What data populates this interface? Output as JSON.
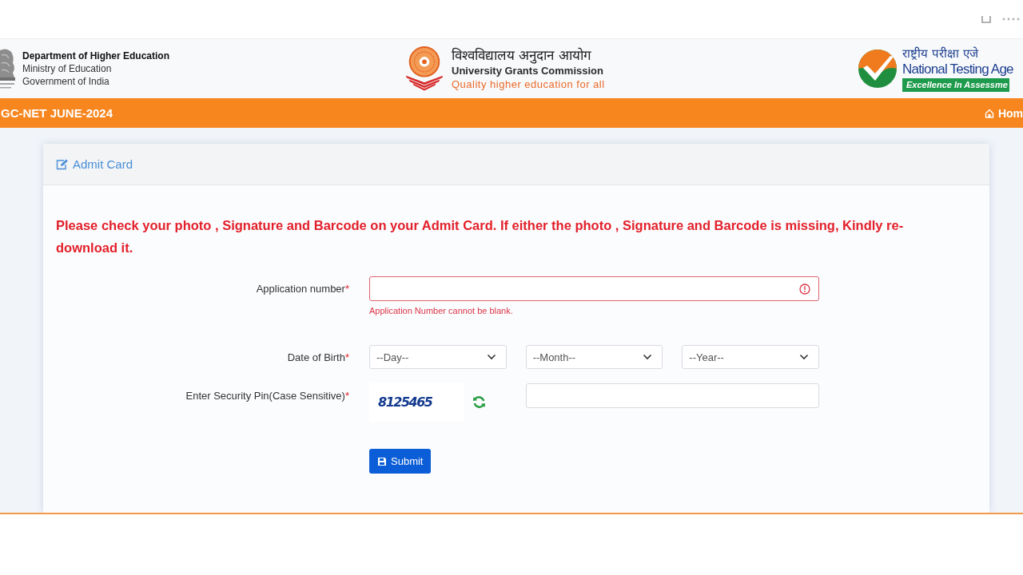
{
  "header": {
    "department": {
      "title": "Department of Higher Education",
      "lines": [
        "Ministry of Education",
        "Government of India"
      ]
    },
    "commission": {
      "name_hindi": "विश्वविद्यालय अनुदान आयोग",
      "name": "University Grants Commission",
      "tagline": "Quality higher education for all"
    },
    "agency": {
      "name_hindi": "राष्ट्रीय परीक्षा एजे",
      "name": "National Testing Age",
      "tagline": "Excellence In Assessme"
    }
  },
  "nav_bar": {
    "title": "GC-NET JUNE-2024",
    "home_link": "Hom"
  },
  "card": {
    "title": "Admit Card",
    "notice": "Please check your photo , Signature and Barcode on your Admit Card. If either the photo , Signature and Barcode is missing, Kindly re-download it.",
    "fields": [
      {
        "kind": "text",
        "label": "Application number",
        "mark": "*",
        "invalid": true,
        "error": "Application Number cannot be blank."
      },
      {
        "kind": "date",
        "label": "Date of Birth",
        "mark": "*",
        "selects": [
          {
            "placeholder": "--Day--"
          },
          {
            "placeholder": "--Month--"
          },
          {
            "placeholder": "--Year--"
          }
        ]
      },
      {
        "kind": "captcha",
        "label": "Enter Security Pin(Case Sensitive)",
        "mark": "*",
        "captcha": "8125465"
      }
    ],
    "submit": "Submit"
  }
}
